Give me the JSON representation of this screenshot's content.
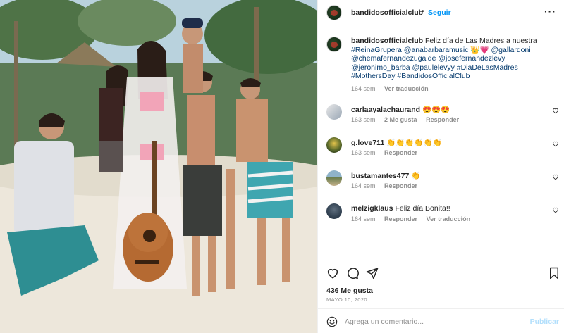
{
  "post": {
    "username": "bandidosofficialclub",
    "follow_label": "Seguir",
    "more_icon": "more-horizontal-icon"
  },
  "caption": {
    "username": "bandidosofficialclub",
    "text": "Feliz día de Las Madres a nuestra",
    "tags": [
      "#ReinaGrupera",
      "@anabarbaramusic 👑💗",
      "@gallardoni",
      "@chemafernandezugalde",
      "@josefernandezlevy",
      "@jeronimo_barba",
      "@paulelevyy",
      "#DiaDeLasMadres",
      "#MothersDay",
      "#BandidosOfficialClub"
    ],
    "time": "164 sem",
    "translate": "Ver traducción"
  },
  "comments": [
    {
      "username": "carlaayalachaurand",
      "text": "😍😍😍",
      "time": "163 sem",
      "likes": "2 Me gusta",
      "reply": "Responder",
      "translate": ""
    },
    {
      "username": "g.love711",
      "text": "👏👏👏👏👏👏",
      "time": "163 sem",
      "likes": "",
      "reply": "Responder",
      "translate": ""
    },
    {
      "username": "bustamantes477",
      "text": "👏",
      "time": "164 sem",
      "likes": "",
      "reply": "Responder",
      "translate": ""
    },
    {
      "username": "melzigklaus",
      "text": "Feliz día Bonita!!",
      "time": "164 sem",
      "likes": "",
      "reply": "Responder",
      "translate": "Ver traducción"
    }
  ],
  "footer": {
    "likes": "436 Me gusta",
    "date": "MAYO 10, 2020",
    "comment_placeholder": "Agrega un comentario...",
    "publish_label": "Publicar"
  },
  "colors": {
    "link_blue": "#0095f6",
    "tag_blue": "#00376b",
    "muted": "#8e8e8e"
  }
}
